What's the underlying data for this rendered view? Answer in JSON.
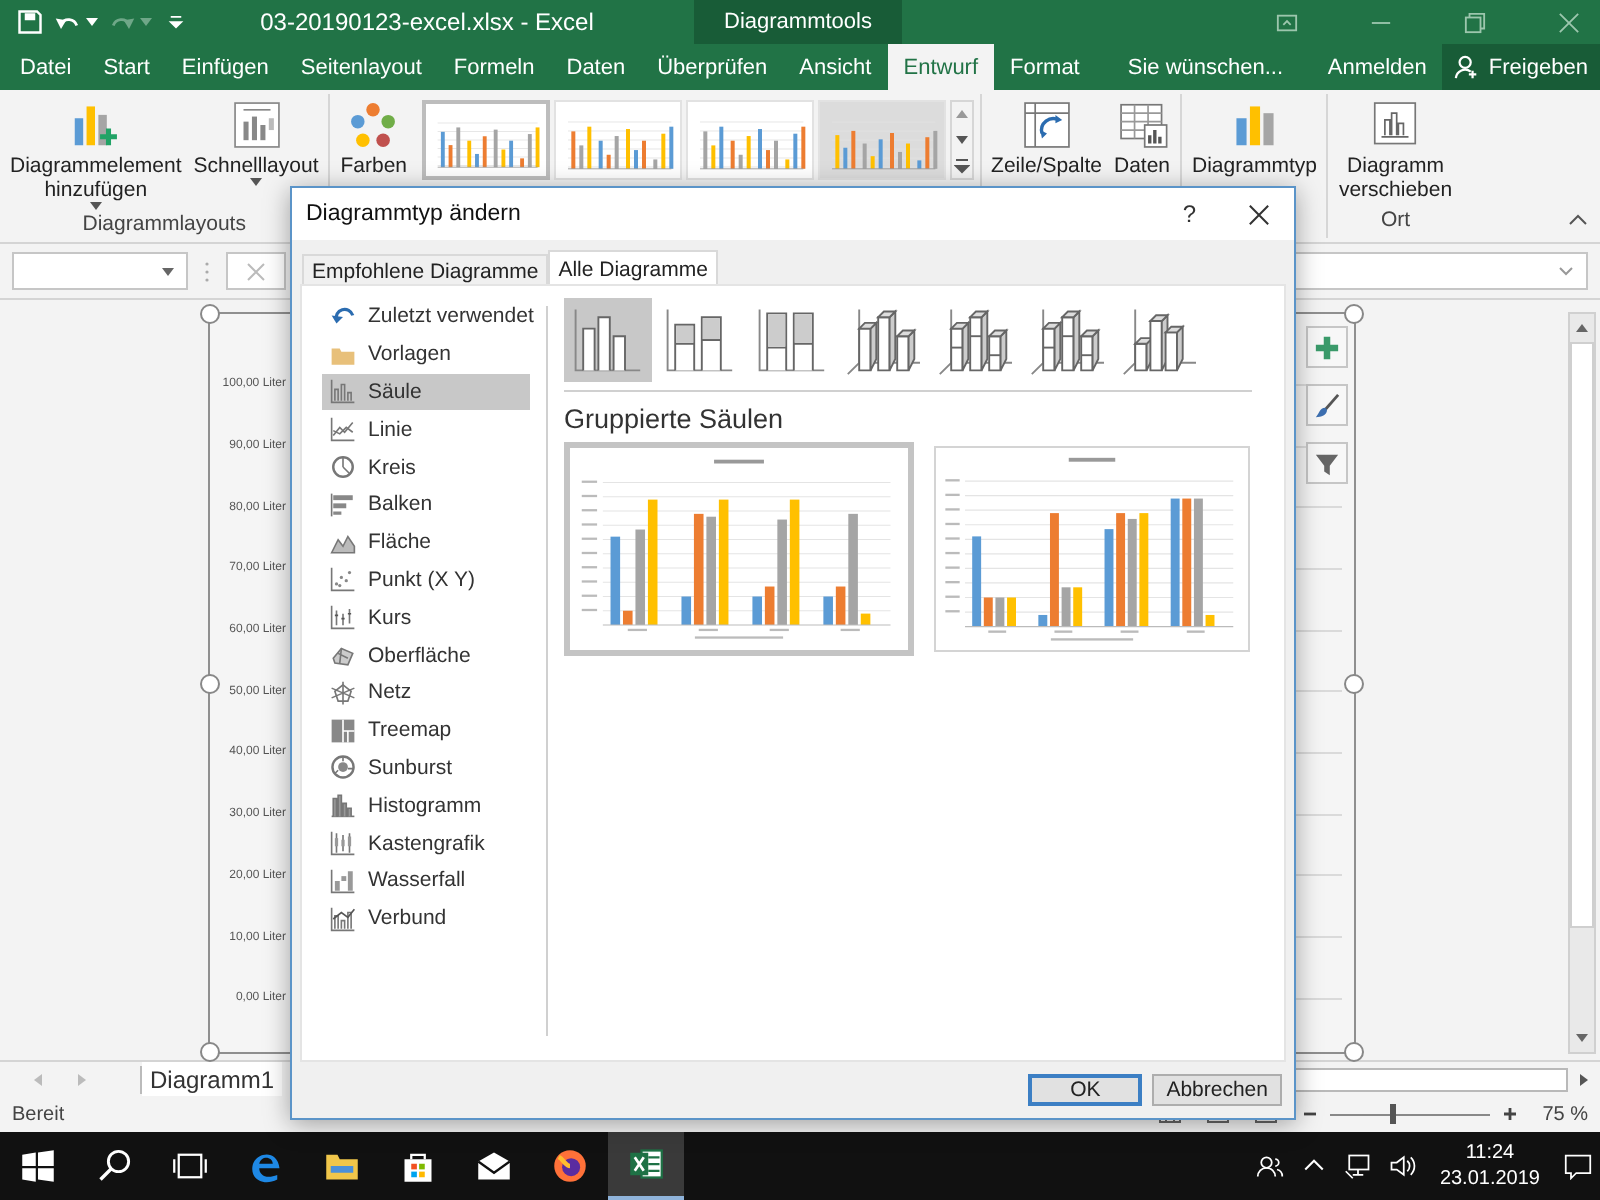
{
  "title_bar": {
    "title": "03-20190123-excel.xlsx - Excel",
    "context_tab": "Diagrammtools"
  },
  "tabs": [
    {
      "label": "Datei",
      "selected": false
    },
    {
      "label": "Start",
      "selected": false
    },
    {
      "label": "Einfügen",
      "selected": false
    },
    {
      "label": "Seitenlayout",
      "selected": false
    },
    {
      "label": "Formeln",
      "selected": false
    },
    {
      "label": "Daten",
      "selected": false
    },
    {
      "label": "Überprüfen",
      "selected": false
    },
    {
      "label": "Ansicht",
      "selected": false
    },
    {
      "label": "Entwurf",
      "selected": true
    },
    {
      "label": "Format",
      "selected": false
    }
  ],
  "tell_me": {
    "placeholder": "Sie wünschen..."
  },
  "account": {
    "sign_in": "Anmelden",
    "share": "Freigeben"
  },
  "ribbon": {
    "add_element": {
      "lines": [
        "Diagrammelement",
        "hinzufügen"
      ],
      "dropdown": true
    },
    "quick_layout": {
      "lines": [
        "Schnelllayout"
      ],
      "dropdown": true
    },
    "layouts_group": "Diagrammlayouts",
    "colors": {
      "lines": [
        "Farben"
      ]
    },
    "styles": [
      {
        "selected": true
      },
      {
        "selected": false
      },
      {
        "selected": false
      },
      {
        "selected": false
      }
    ],
    "switch_row_col": {
      "lines": [
        "Zeile/Spalte"
      ]
    },
    "select_data": {
      "lines": [
        "Daten"
      ]
    },
    "change_type": {
      "lines": [
        "Diagrammtyp"
      ]
    },
    "move_chart": {
      "lines": [
        "Diagramm",
        "verschieben"
      ]
    },
    "location_group": "Ort"
  },
  "sheet": {
    "axis_labels": [
      "100,00 Liter",
      "90,00 Liter",
      "80,00 Liter",
      "70,00 Liter",
      "60,00 Liter",
      "50,00 Liter",
      "40,00 Liter",
      "30,00 Liter",
      "20,00 Liter",
      "10,00 Liter",
      "0,00 Liter"
    ],
    "sheet_tab": "Diagramm1"
  },
  "status_bar": {
    "status": "Bereit",
    "zoom_slider": {
      "level": 0.38
    },
    "zoom": "75 %"
  },
  "taskbar": {
    "time": "11:24",
    "date": "23.01.2019"
  },
  "dialog": {
    "title": "Diagrammtyp ändern",
    "help": "?",
    "tabs": [
      {
        "label": "Empfohlene Diagramme",
        "selected": false
      },
      {
        "label": "Alle Diagramme",
        "selected": true
      }
    ],
    "categories": [
      {
        "label": "Zuletzt verwendet",
        "selected": false
      },
      {
        "label": "Vorlagen",
        "selected": false
      },
      {
        "label": "Säule",
        "selected": true
      },
      {
        "label": "Linie",
        "selected": false
      },
      {
        "label": "Kreis",
        "selected": false
      },
      {
        "label": "Balken",
        "selected": false
      },
      {
        "label": "Fläche",
        "selected": false
      },
      {
        "label": "Punkt (X Y)",
        "selected": false
      },
      {
        "label": "Kurs",
        "selected": false
      },
      {
        "label": "Oberfläche",
        "selected": false
      },
      {
        "label": "Netz",
        "selected": false
      },
      {
        "label": "Treemap",
        "selected": false
      },
      {
        "label": "Sunburst",
        "selected": false
      },
      {
        "label": "Histogramm",
        "selected": false
      },
      {
        "label": "Kastengrafik",
        "selected": false
      },
      {
        "label": "Wasserfall",
        "selected": false
      },
      {
        "label": "Verbund",
        "selected": false
      }
    ],
    "subtypes": [
      {
        "selected": true
      },
      {
        "selected": false
      },
      {
        "selected": false
      },
      {
        "selected": false
      },
      {
        "selected": false
      },
      {
        "selected": false
      },
      {
        "selected": false
      }
    ],
    "subtype_title": "Gruppierte Säulen",
    "previews": [
      {
        "selected": true
      },
      {
        "selected": false
      }
    ],
    "buttons": [
      {
        "label": "OK",
        "default": true
      },
      {
        "label": "Abbrechen",
        "default": false
      }
    ]
  }
}
